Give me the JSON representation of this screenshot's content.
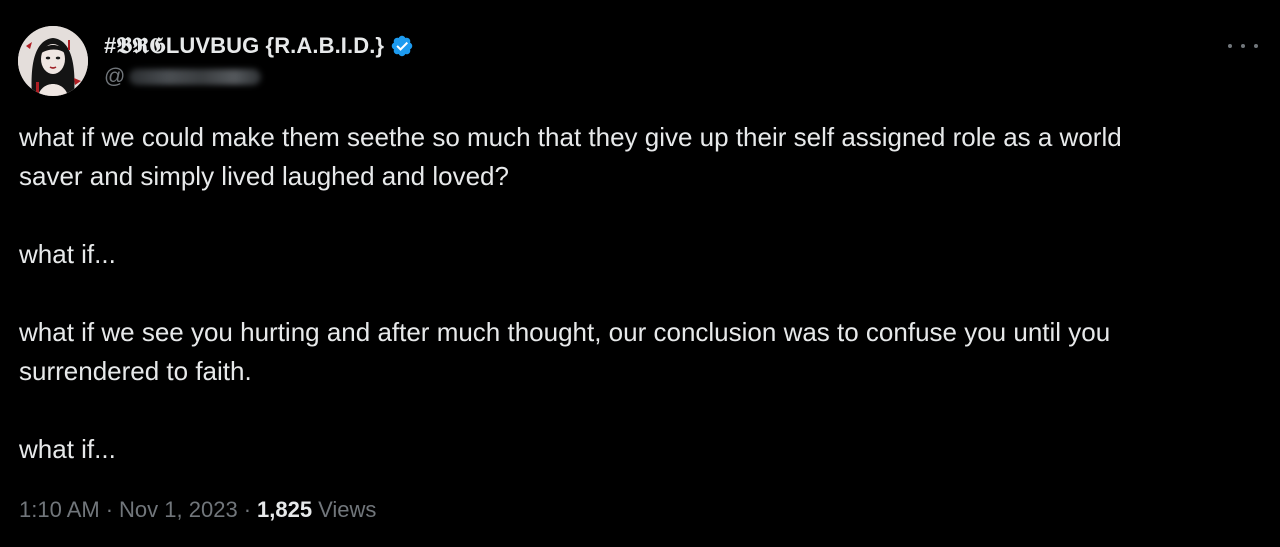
{
  "author": {
    "display_name": "#𝕭𝕽𝕲LUVBUG {R.A.B.I.D.}",
    "handle_prefix": "@",
    "verified": true,
    "avatar_icon": "profile-avatar"
  },
  "more_icon": "more-horizontal-icon",
  "tweet": {
    "paragraphs": [
      "what if we could make them seethe so much that they give up their self assigned role as a world\nsaver and simply lived laughed and loved?",
      "what if...",
      "what if we see you hurting and after much thought, our conclusion was to confuse you until you\nsurrendered to faith.",
      "what if..."
    ]
  },
  "meta": {
    "time": "1:10 AM",
    "date": "Nov 1, 2023",
    "separator": "·",
    "views_count": "1,825",
    "views_label": "Views"
  },
  "colors": {
    "background": "#000000",
    "text_primary": "#e7e9ea",
    "text_secondary": "#71767b",
    "verified_blue": "#1d9bf0"
  }
}
